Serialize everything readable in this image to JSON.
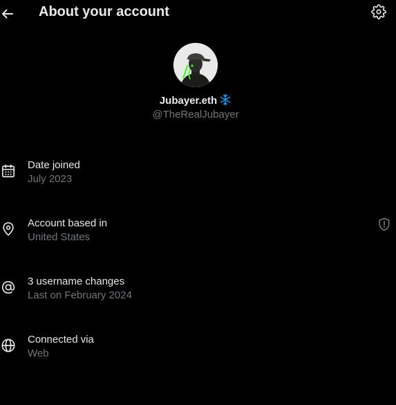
{
  "header": {
    "title": "About your account",
    "back_icon": "arrow-left-icon",
    "settings_icon": "gear-icon"
  },
  "profile": {
    "display_name": "Jubayer.eth",
    "name_emoji": "snowflake-icon",
    "handle": "@TheRealJubayer",
    "avatar_icon": "avatar"
  },
  "info": [
    {
      "icon": "calendar-icon",
      "title": "Date joined",
      "subtitle": "July 2023"
    },
    {
      "icon": "location-pin-icon",
      "title": "Account based in",
      "subtitle": "United States",
      "action_icon": "shield-alert-icon"
    },
    {
      "icon": "at-sign-icon",
      "title": "3 username changes",
      "subtitle": "Last on February 2024"
    },
    {
      "icon": "globe-icon",
      "title": "Connected via",
      "subtitle": "Web"
    }
  ],
  "colors": {
    "background": "#000000",
    "primary_text": "#e7e9ea",
    "secondary_text": "#71767b",
    "snowflake": "#1d9bf0",
    "avatar_accent": "#39ff14"
  }
}
